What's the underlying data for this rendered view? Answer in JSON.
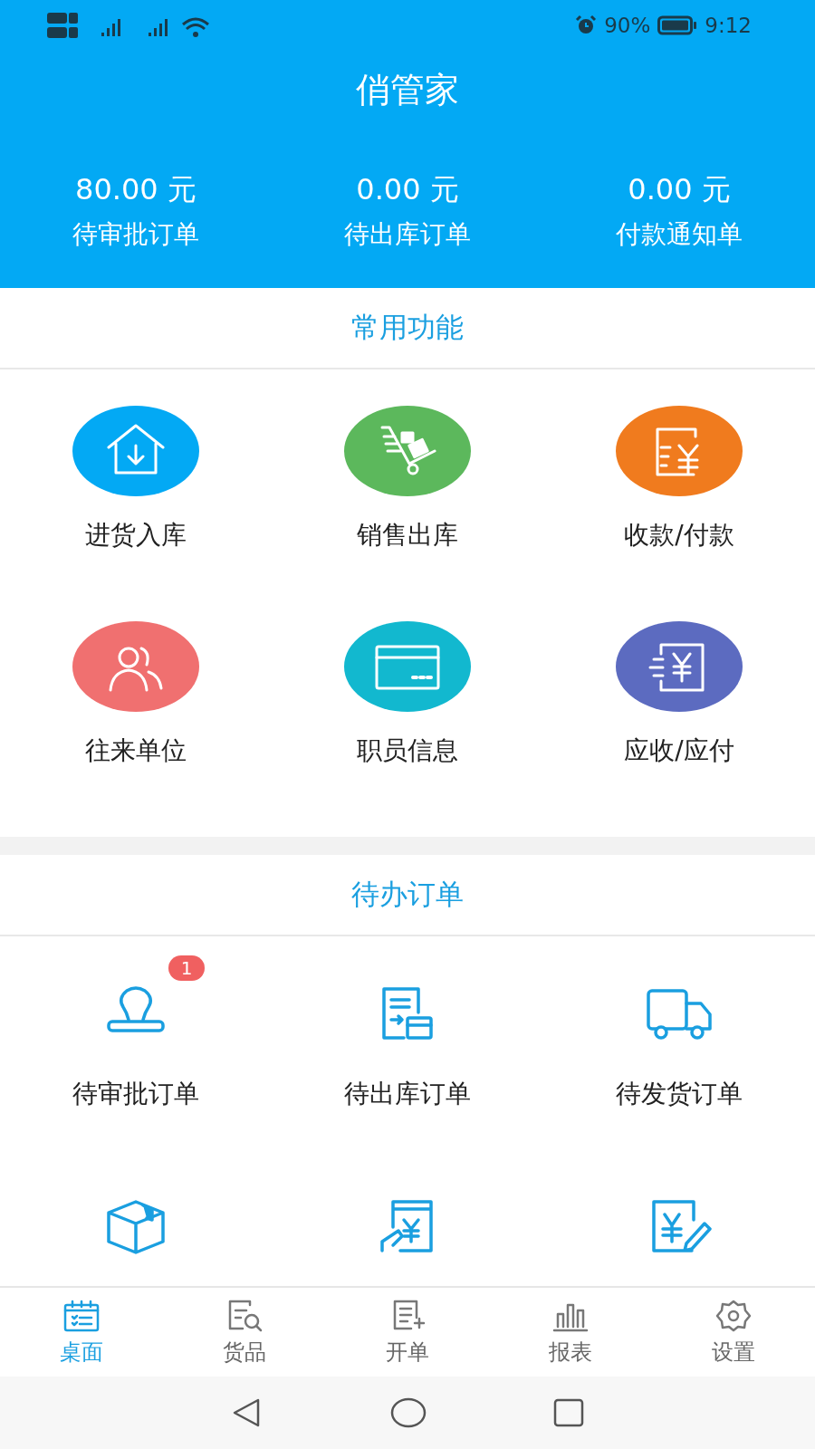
{
  "status_bar": {
    "battery": "90%",
    "time": "9:12"
  },
  "app_title": "俏管家",
  "summary": [
    {
      "amount": "80.00 元",
      "label": "待审批订单"
    },
    {
      "amount": "0.00 元",
      "label": "待出库订单"
    },
    {
      "amount": "0.00 元",
      "label": "付款通知单"
    }
  ],
  "common_functions": {
    "title": "常用功能",
    "items": [
      {
        "label": "进货入库",
        "color": "#03a9f4"
      },
      {
        "label": "销售出库",
        "color": "#5cb85c"
      },
      {
        "label": "收款/付款",
        "color": "#f07b1e"
      },
      {
        "label": "往来单位",
        "color": "#f07070"
      },
      {
        "label": "职员信息",
        "color": "#12b8cf"
      },
      {
        "label": "应收/应付",
        "color": "#5c6bc0"
      }
    ]
  },
  "pending_orders": {
    "title": "待办订单",
    "items": [
      {
        "kind": "labeled",
        "label": "待审批订单",
        "badge": "1"
      },
      {
        "kind": "labeled",
        "label": "待出库订单"
      },
      {
        "kind": "labeled",
        "label": "待发货订单"
      },
      {
        "kind": "icon_only"
      },
      {
        "kind": "icon_only"
      },
      {
        "kind": "icon_only"
      }
    ]
  },
  "tabs": [
    {
      "label": "桌面",
      "selected": true
    },
    {
      "label": "货品",
      "selected": false
    },
    {
      "label": "开单",
      "selected": false
    },
    {
      "label": "报表",
      "selected": false
    },
    {
      "label": "设置",
      "selected": false
    }
  ]
}
